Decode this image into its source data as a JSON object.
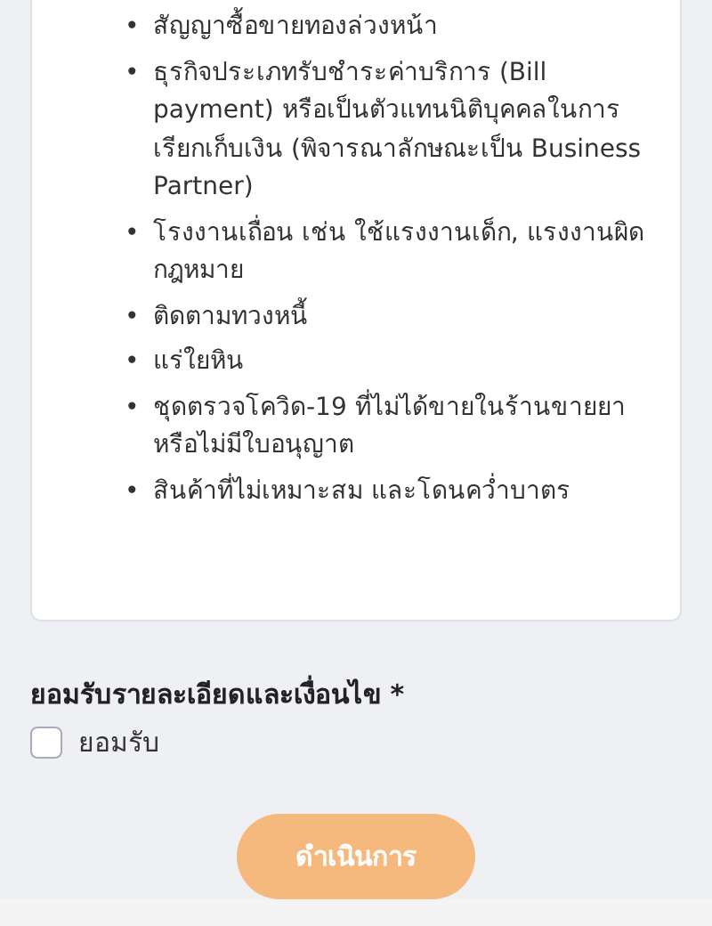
{
  "card": {
    "list_items": [
      {
        "marker": "•",
        "text": "สัญญาซื้อขายทองล่วงหน้า"
      },
      {
        "marker": "•",
        "text": "ธุรกิจประเภทรับชำระค่าบริการ (Bill payment) หรือเป็นตัวแทนนิติบุคคลในการเรียกเก็บเงิน (พิจารณาลักษณะเป็น Business Partner)"
      },
      {
        "marker": "•",
        "text": "โรงงานเถื่อน เช่น ใช้แรงงานเด็ก, แรงงานผิดกฎหมาย"
      },
      {
        "marker": "•",
        "text": "ติดตามทวงหนี้"
      },
      {
        "marker": "•",
        "text": "แร่ใยหิน"
      },
      {
        "marker": "•",
        "text": "ชุดตรวจโควิด-19 ที่ไม่ได้ขายในร้านขายยาหรือไม่มีใบอนุญาต"
      },
      {
        "marker": "•",
        "text": "สินค้าที่ไม่เหมาะสม และโดนคว่ำบาตร"
      }
    ]
  },
  "consent": {
    "heading": "ยอมรับรายละเอียดและเงื่อนไข *",
    "checkbox": {
      "label": "ยอมรับ",
      "checked": false
    }
  },
  "submit_button": {
    "label": "ดำเนินการ",
    "disabled": true
  }
}
